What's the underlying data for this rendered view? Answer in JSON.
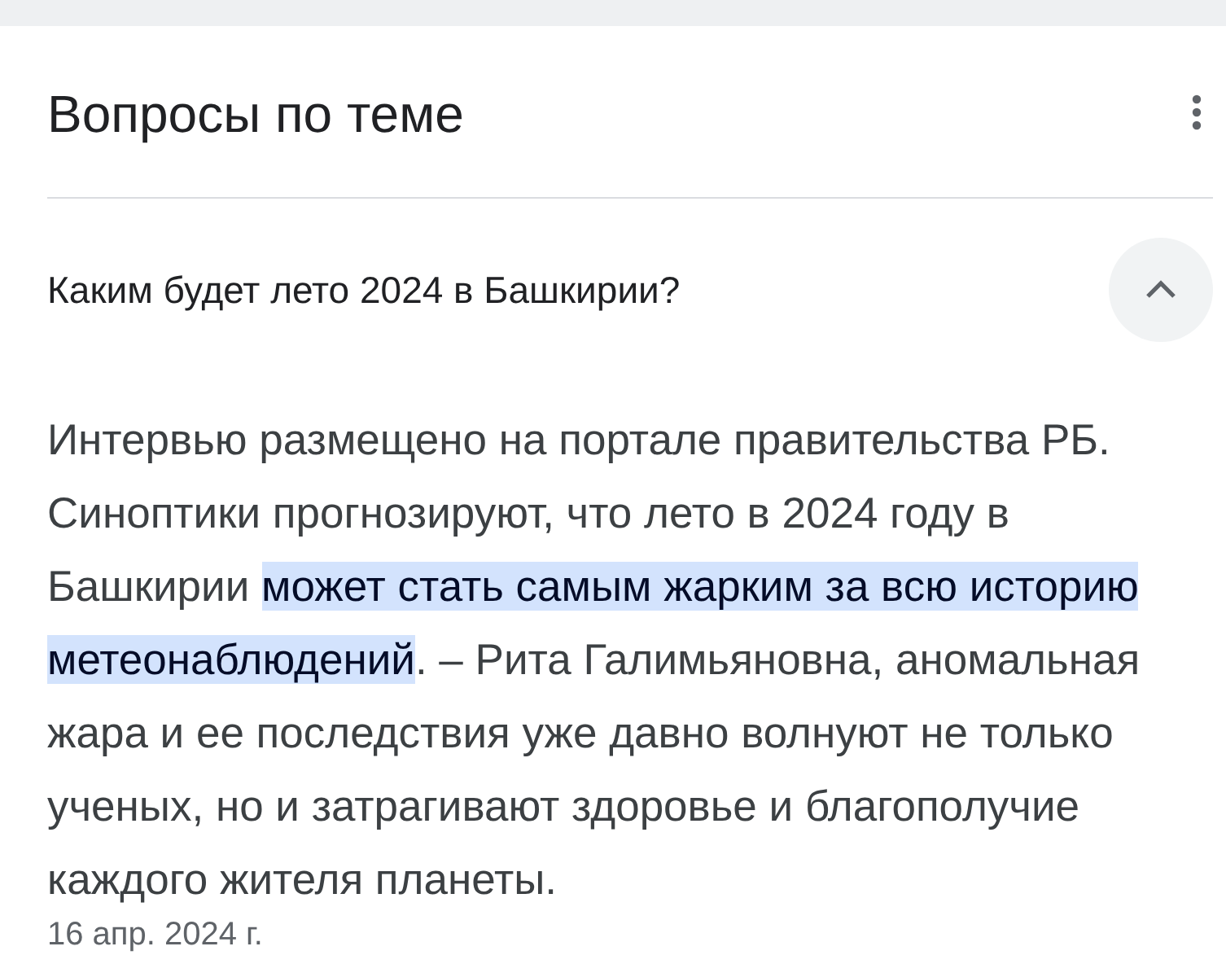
{
  "section": {
    "title": "Вопросы по теме"
  },
  "questions": [
    {
      "question": "Каким будет лето 2024 в Башкирии?",
      "expanded": true,
      "answer": {
        "text_before": "Интервью размещено на портале правительства РБ. Синоптики прогнозируют, что лето в 2024 году в Башкирии ",
        "highlight": "может стать самым жарким за всю историю метеонаблюдений",
        "text_after": ". – Рита Галимьяновна, аномальная жара и ее последствия уже давно волнуют не только ученых, но и затрагивают здоровье и благополучие каждого жителя планеты."
      },
      "date": "16 апр. 2024 г."
    }
  ]
}
